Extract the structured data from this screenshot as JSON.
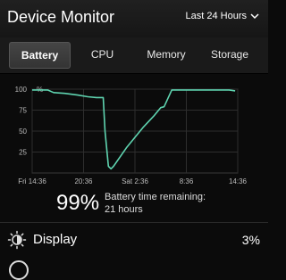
{
  "app": {
    "title": "Device Monitor"
  },
  "range": {
    "selected": "Last 24 Hours"
  },
  "tabs": [
    {
      "label": "Battery",
      "active": true
    },
    {
      "label": "CPU",
      "active": false
    },
    {
      "label": "Memory",
      "active": false
    },
    {
      "label": "Storage",
      "active": false
    }
  ],
  "chart_data": {
    "type": "line",
    "unit_label": "%",
    "ylim": [
      0,
      100
    ],
    "y_ticks": [
      100,
      75,
      50,
      25
    ],
    "x_ticks": [
      "Fri 14:36",
      "20:36",
      "Sat 2:36",
      "8:36",
      "14:36"
    ],
    "x_hours": [
      0,
      6,
      12,
      18,
      24
    ],
    "grid": true,
    "color": "#5fd4b0",
    "series": [
      {
        "x": [
          0,
          1.8,
          2.5,
          3.8,
          5.3,
          6.5,
          7.5,
          8.3,
          8.5,
          8.9,
          9.2,
          9.5,
          11,
          13,
          14.2,
          15.0,
          15.4,
          16.3,
          21,
          23,
          23.7
        ],
        "y": [
          99,
          99,
          96,
          95,
          93,
          91,
          90,
          90,
          50,
          8,
          5,
          8,
          30,
          55,
          68,
          78,
          79,
          99,
          99,
          99,
          98
        ]
      }
    ]
  },
  "summary": {
    "percent": "99%",
    "line1": "Battery time remaining:",
    "line2": "21 hours"
  },
  "list": [
    {
      "label": "Display",
      "value": "3%",
      "icon": "brightness-icon"
    }
  ]
}
